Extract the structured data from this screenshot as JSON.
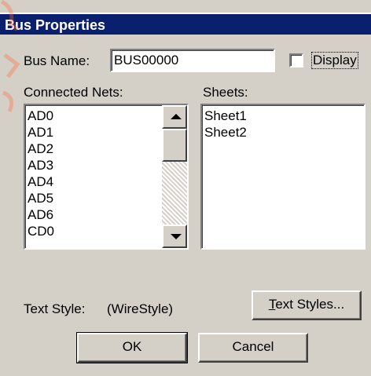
{
  "window": {
    "title": "Bus Properties"
  },
  "bus_name": {
    "label": "Bus Name:",
    "value": "BUS00000"
  },
  "display": {
    "label": "Display",
    "checked": false
  },
  "connected_nets": {
    "label": "Connected Nets:",
    "items": [
      "AD0",
      "AD1",
      "AD2",
      "AD3",
      "AD4",
      "AD5",
      "AD6",
      "CD0"
    ]
  },
  "sheets": {
    "label": "Sheets:",
    "items": [
      "Sheet1",
      "Sheet2"
    ]
  },
  "text_style": {
    "label": "Text Style:",
    "value": "(WireStyle)"
  },
  "buttons": {
    "text_styles": {
      "mnemonic": "T",
      "rest": "ext Styles..."
    },
    "ok": "OK",
    "cancel": "Cancel"
  },
  "icons": {
    "scroll_up": "up-arrow",
    "scroll_down": "down-arrow"
  }
}
